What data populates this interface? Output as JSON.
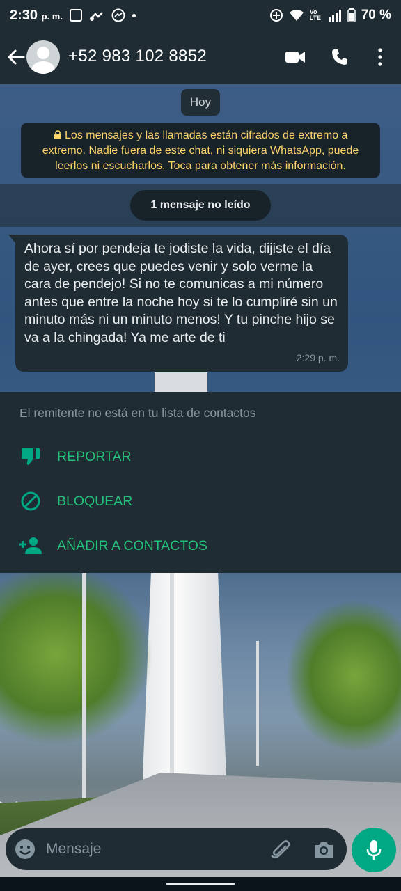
{
  "status_bar": {
    "time": "2:30",
    "time_suffix": "p. m.",
    "network_label": "Vo LTE",
    "battery": "70 %"
  },
  "header": {
    "contact_name": "+52 983 102 8852",
    "icons": [
      "back-arrow-icon",
      "avatar",
      "video-call-icon",
      "voice-call-icon",
      "more-options-icon"
    ]
  },
  "chat": {
    "date_label": "Hoy",
    "encryption_notice": "Los mensajes y las llamadas están cifrados de extremo a extremo. Nadie fuera de este chat, ni siquiera WhatsApp, puede leerlos ni escucharlos. Toca para obtener más información.",
    "unread_label": "1 mensaje no leído",
    "messages": [
      {
        "direction": "incoming",
        "text": "Ahora sí por pendeja te jodiste la vida, dijiste el día de ayer, crees que puedes venir y solo verme la cara de pendejo! Si no te comunicas a mi número antes que entre la noche hoy si te lo cumpliré sin un minuto más ni un minuto menos! Y tu pinche hijo se va a la chingada! Ya me arte de ti",
        "time": "2:29 p. m."
      }
    ]
  },
  "unknown_sender": {
    "notice": "El remitente no está en tu lista de contactos",
    "actions": [
      {
        "label": "REPORTAR",
        "icon": "thumbs-down-icon"
      },
      {
        "label": "BLOQUEAR",
        "icon": "block-icon"
      },
      {
        "label": "AÑADIR A CONTACTOS",
        "icon": "add-contact-icon"
      }
    ]
  },
  "input": {
    "placeholder": "Mensaje"
  },
  "colors": {
    "accent": "#00a884",
    "action_text": "#25c07a",
    "header_bg": "#1f2c33",
    "bubble_bg": "#202c33",
    "notice_text": "#fdd36a"
  }
}
